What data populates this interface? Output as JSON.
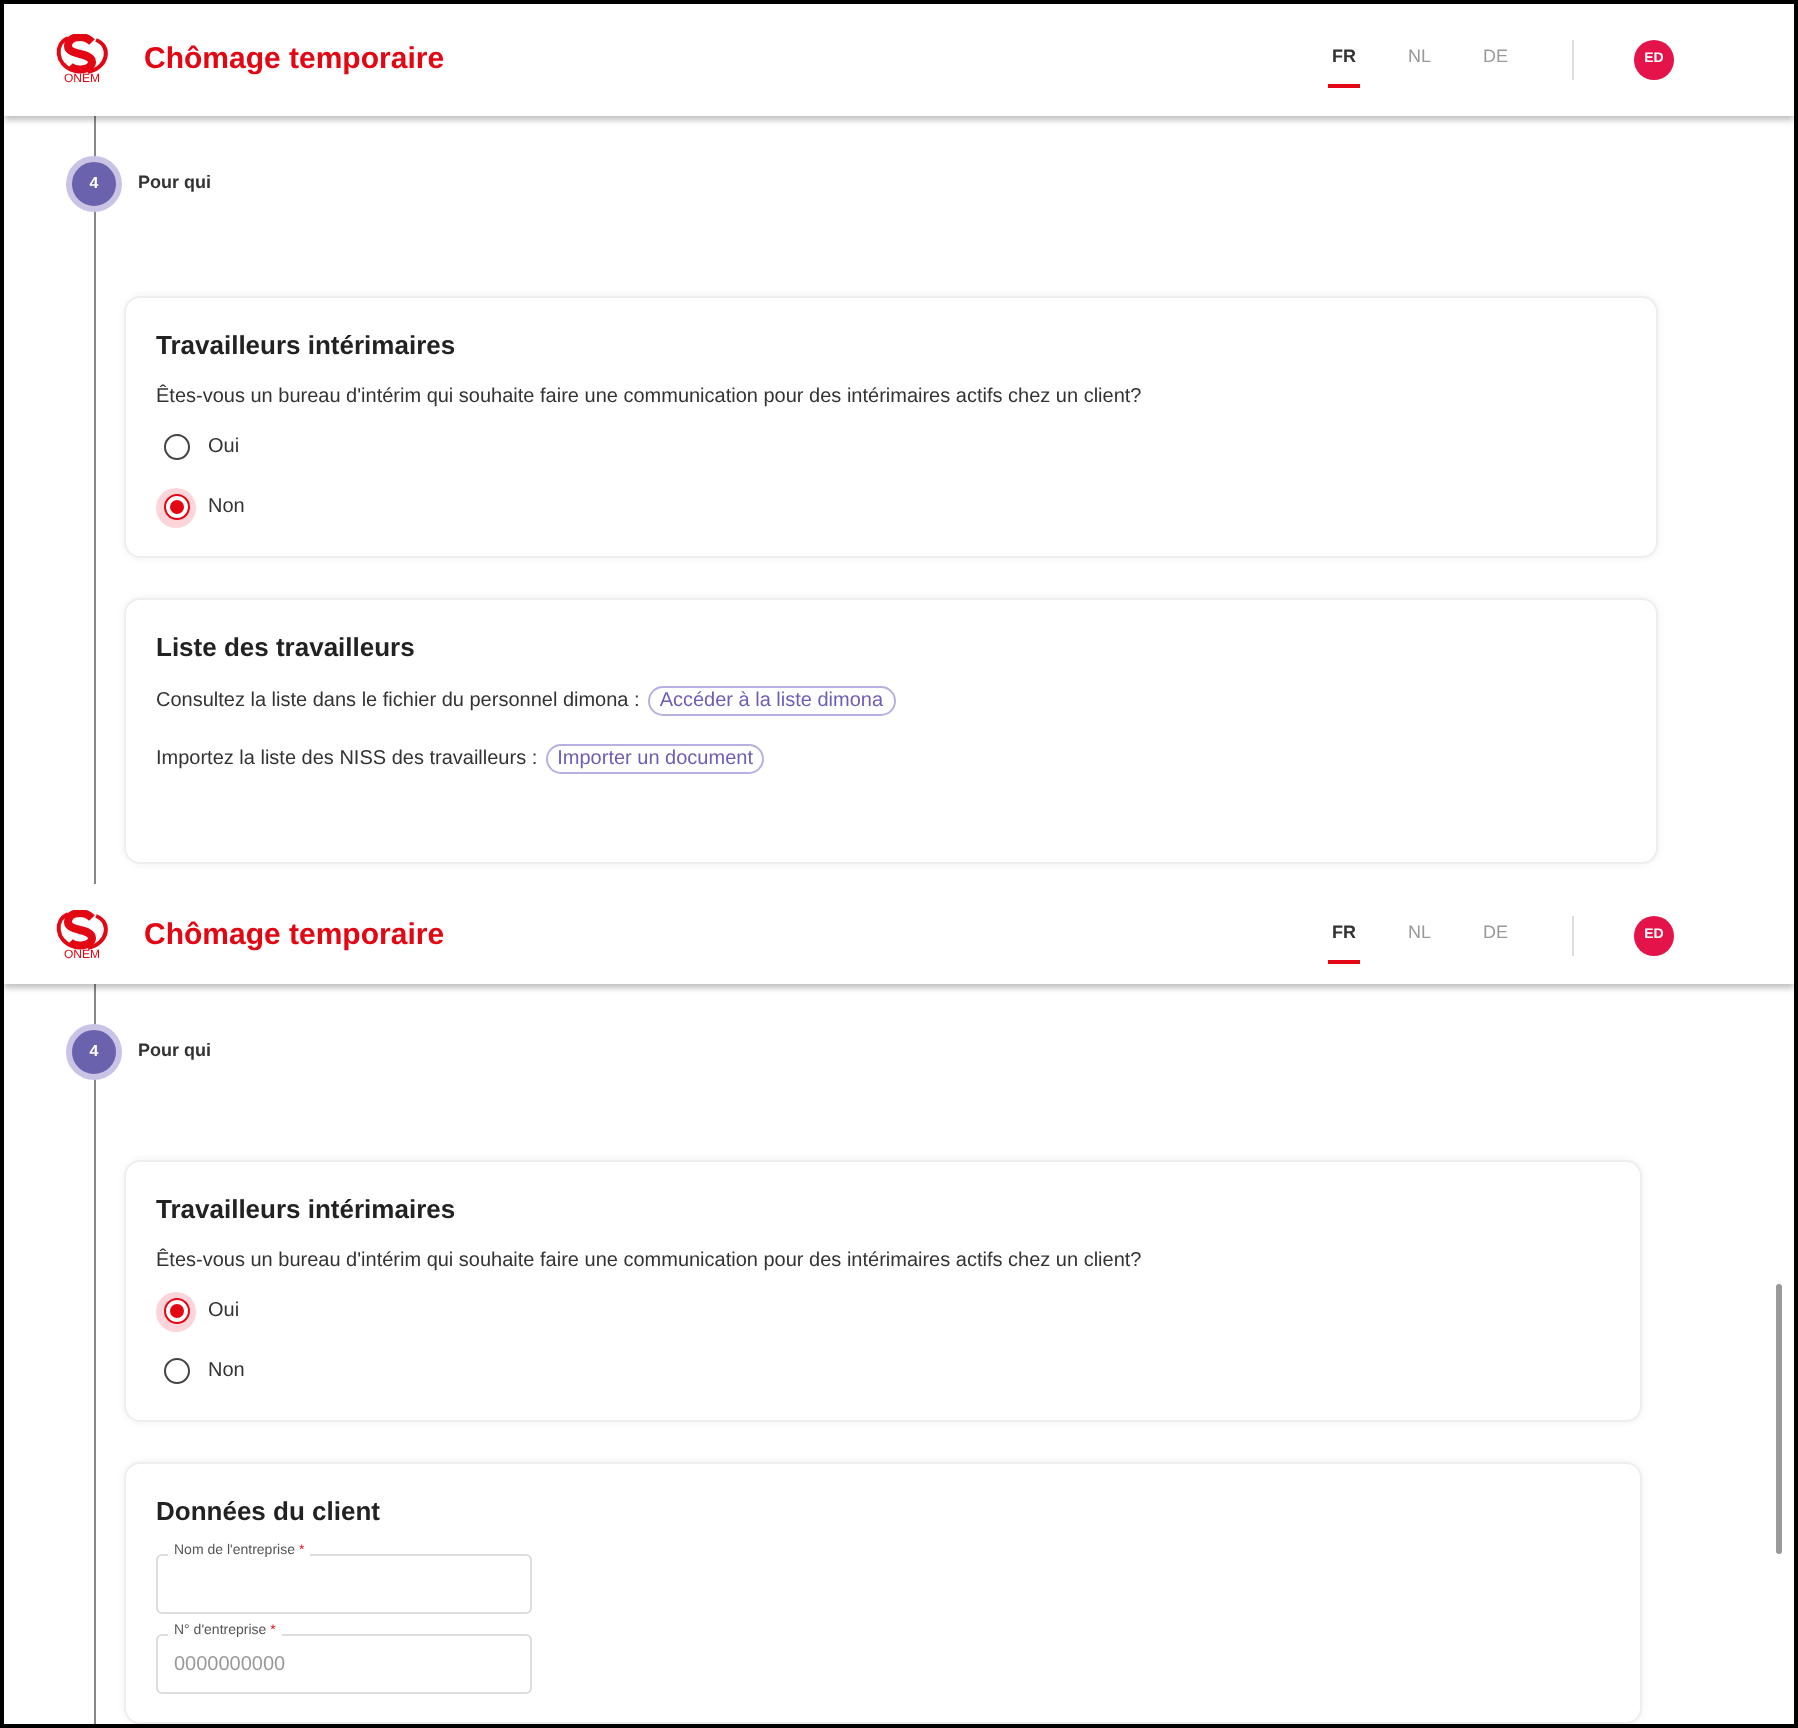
{
  "panels": [
    {
      "header": {
        "logo_text": "ONEM",
        "title": "Chômage temporaire",
        "languages": [
          {
            "label": "FR",
            "selected": true
          },
          {
            "label": "NL",
            "selected": false
          },
          {
            "label": "DE",
            "selected": false
          }
        ],
        "avatar": "ED"
      },
      "step": {
        "number": "4",
        "label": "Pour qui"
      },
      "scrollbar": false,
      "cards": [
        {
          "kind": "radio",
          "title": "Travailleurs intérimaires",
          "question": "Êtes-vous un bureau d'intérim qui souhaite faire une communication pour des intérimaires actifs chez un client?",
          "options": [
            {
              "label": "Oui",
              "selected": false
            },
            {
              "label": "Non",
              "selected": true
            }
          ]
        },
        {
          "kind": "links",
          "title": "Liste des travailleurs",
          "rows": [
            {
              "text": "Consultez la liste dans le fichier du personnel dimona :",
              "button": "Accéder à la liste dimona"
            },
            {
              "text": "Importez la liste des NISS des travailleurs :",
              "button": "Importer un document"
            }
          ]
        }
      ]
    },
    {
      "header": {
        "logo_text": "ONEM",
        "title": "Chômage temporaire",
        "languages": [
          {
            "label": "FR",
            "selected": true
          },
          {
            "label": "NL",
            "selected": false
          },
          {
            "label": "DE",
            "selected": false
          }
        ],
        "avatar": "ED"
      },
      "step": {
        "number": "4",
        "label": "Pour qui"
      },
      "scrollbar": true,
      "cards": [
        {
          "kind": "radio",
          "title": "Travailleurs intérimaires",
          "question": "Êtes-vous un bureau d'intérim qui souhaite faire une communication pour des intérimaires actifs chez un client?",
          "options": [
            {
              "label": "Oui",
              "selected": true
            },
            {
              "label": "Non",
              "selected": false
            }
          ]
        },
        {
          "kind": "fields",
          "title": "Données du client",
          "fields": [
            {
              "label": "Nom de l'entreprise",
              "required_mark": "*"
            },
            {
              "label": "N° d'entreprise",
              "required_mark": "*",
              "placeholder": "0000000000"
            }
          ]
        }
      ]
    }
  ]
}
